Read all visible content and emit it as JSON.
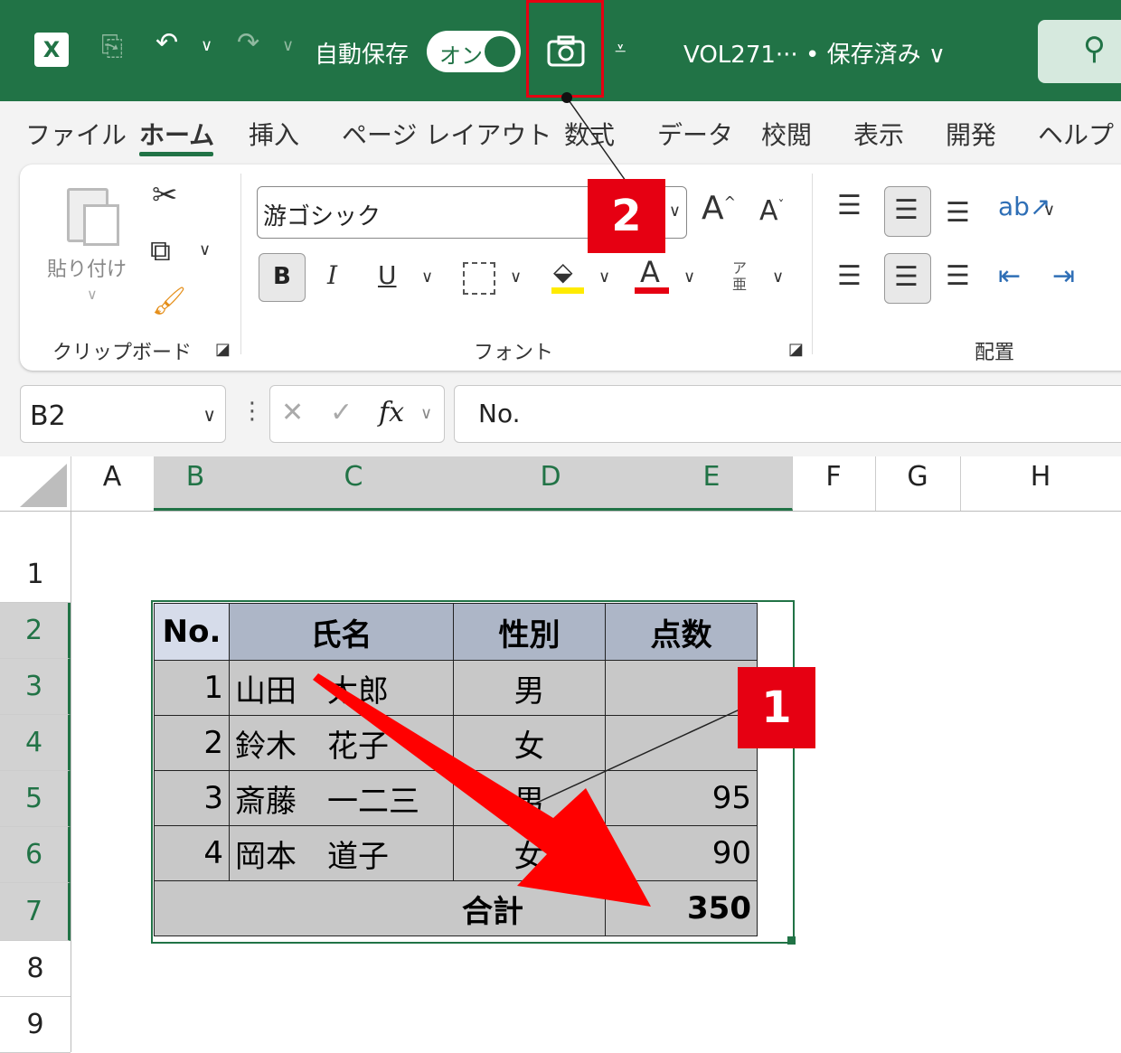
{
  "titlebar": {
    "autosave_label": "自動保存",
    "toggle_label": "オン",
    "filename": "VOL271··· • 保存済み ∨"
  },
  "tabs": [
    "ファイル",
    "ホーム",
    "挿入",
    "ページ レイアウト",
    "数式",
    "データ",
    "校閲",
    "表示",
    "開発",
    "ヘルプ"
  ],
  "ribbon": {
    "paste_label": "貼り付け",
    "clipboard_group": "クリップボード",
    "font_name": "游ゴシック",
    "font_group": "フォント",
    "align_group": "配置",
    "bold": "B",
    "italic": "I",
    "underline": "U",
    "grow": "A",
    "shrink": "A",
    "font_color": "A",
    "phonetic": "ア\n亜"
  },
  "formula_bar": {
    "name_box": "B2",
    "fx": "fx",
    "content": "No."
  },
  "columns": [
    "A",
    "B",
    "C",
    "D",
    "E",
    "F",
    "G",
    "H"
  ],
  "rows": [
    "1",
    "2",
    "3",
    "4",
    "5",
    "6",
    "7",
    "8",
    "9"
  ],
  "table": {
    "headers": [
      "No.",
      "氏名",
      "性別",
      "点数"
    ],
    "rows": [
      [
        "1",
        "山田　太郎",
        "男",
        ""
      ],
      [
        "2",
        "鈴木　花子",
        "女",
        ""
      ],
      [
        "3",
        "斎藤　一二三",
        "男",
        "95"
      ],
      [
        "4",
        "岡本　道子",
        "女",
        "90"
      ]
    ],
    "total_label": "合計",
    "total_value": "350"
  },
  "annotations": {
    "badge1": "1",
    "badge2": "2"
  },
  "colors": {
    "excel_green": "#217346",
    "annotation_red": "#e60012"
  }
}
